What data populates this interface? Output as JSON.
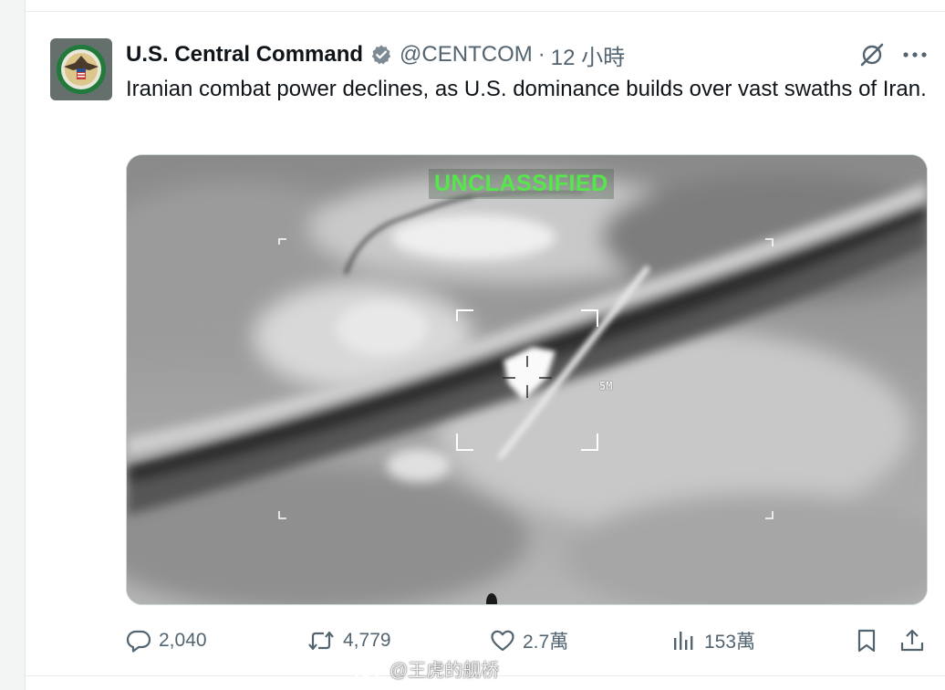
{
  "tweet": {
    "author": {
      "display_name": "U.S. Central Command",
      "handle": "@CENTCOM",
      "verified_icon": "verified-badge-icon",
      "avatar": "centcom-seal"
    },
    "separator": "·",
    "timestamp": "12 小時",
    "text": "Iranian combat power declines, as U.S. dominance builds over vast swaths of Iran.",
    "media": {
      "overlay_label": "UNCLASSIFIED",
      "range_label": "5M",
      "overlay_color": "#54e84a"
    },
    "actions": {
      "replies": "2,040",
      "reposts": "4,779",
      "likes": "2.7萬",
      "views": "153萬"
    }
  },
  "watermark": {
    "text": "@王虎的舰桥"
  },
  "colors": {
    "text_primary": "#0f1419",
    "text_secondary": "#536471",
    "badge": "#7c8a96",
    "page_bg": "#f3f4f4"
  }
}
